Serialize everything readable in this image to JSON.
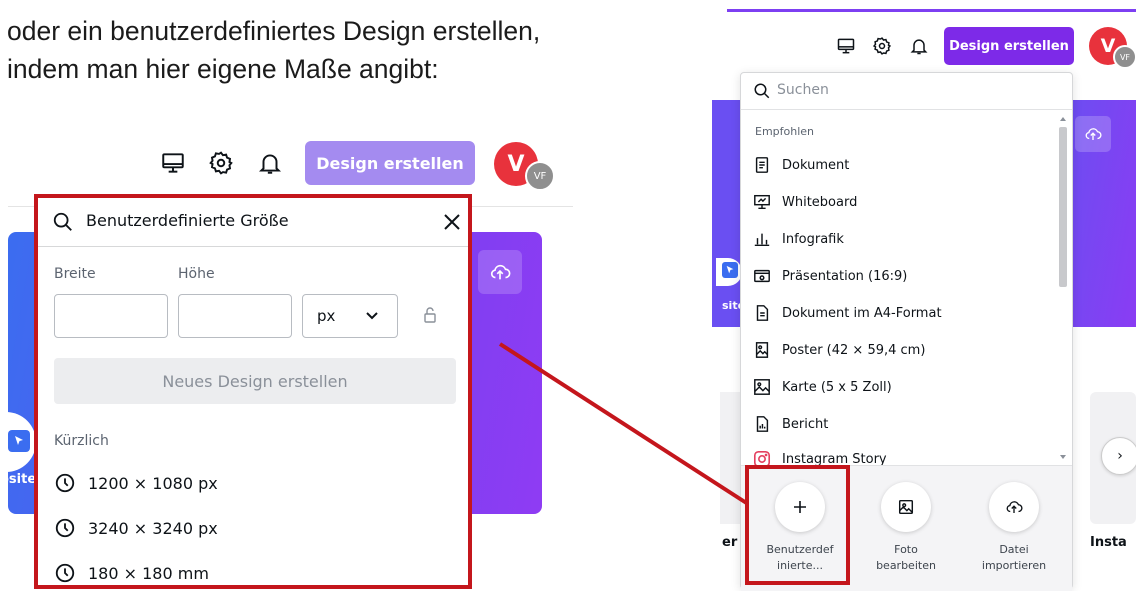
{
  "caption": {
    "line1": "oder ein benutzerdefiniertes Design erstellen,",
    "line2": "indem man hier eigene Maße angibt:"
  },
  "left": {
    "create_button": "Design erstellen",
    "avatar_initial": "V",
    "avatar_badge": "VF",
    "search_value": "Benutzerdefinierte Größe",
    "width_label": "Breite",
    "height_label": "Höhe",
    "unit_value": "px",
    "new_design_button": "Neues Design erstellen",
    "recent_title": "Kürzlich",
    "recent_items": [
      "1200 × 1080 px",
      "3240 × 3240 px",
      "180 × 180 mm"
    ],
    "side_text": "osite"
  },
  "right": {
    "create_button": "Design erstellen",
    "avatar_initial": "V",
    "avatar_badge": "VF",
    "search_placeholder": "Suchen",
    "section": "Empfohlen",
    "items": [
      {
        "label": "Dokument",
        "icon": "document-icon"
      },
      {
        "label": "Whiteboard",
        "icon": "whiteboard-icon"
      },
      {
        "label": "Infografik",
        "icon": "infographic-icon"
      },
      {
        "label": "Präsentation (16:9)",
        "icon": "presentation-icon"
      },
      {
        "label": "Dokument im A4-Format",
        "icon": "a4-document-icon"
      },
      {
        "label": "Poster (42 × 59,4 cm)",
        "icon": "poster-icon"
      },
      {
        "label": "Karte (5 x 5 Zoll)",
        "icon": "card-icon"
      },
      {
        "label": "Bericht",
        "icon": "report-icon"
      },
      {
        "label": "Instagram Story",
        "icon": "instagram-icon"
      }
    ],
    "quick_actions": [
      {
        "line1": "Benutzerdef",
        "line2": "inierte..."
      },
      {
        "line1": "Foto",
        "line2": "bearbeiten"
      },
      {
        "line1": "Datei",
        "line2": "importieren"
      }
    ],
    "side_text": "site",
    "bottom_left_label": "er",
    "bottom_right_label": "Insta",
    "next_chevron": "›"
  },
  "colors": {
    "brand_purple": "#7d2ae8",
    "brand_purple_disabled": "#a48bf0",
    "highlight_red": "#c4161c",
    "avatar_red": "#e8323c"
  }
}
